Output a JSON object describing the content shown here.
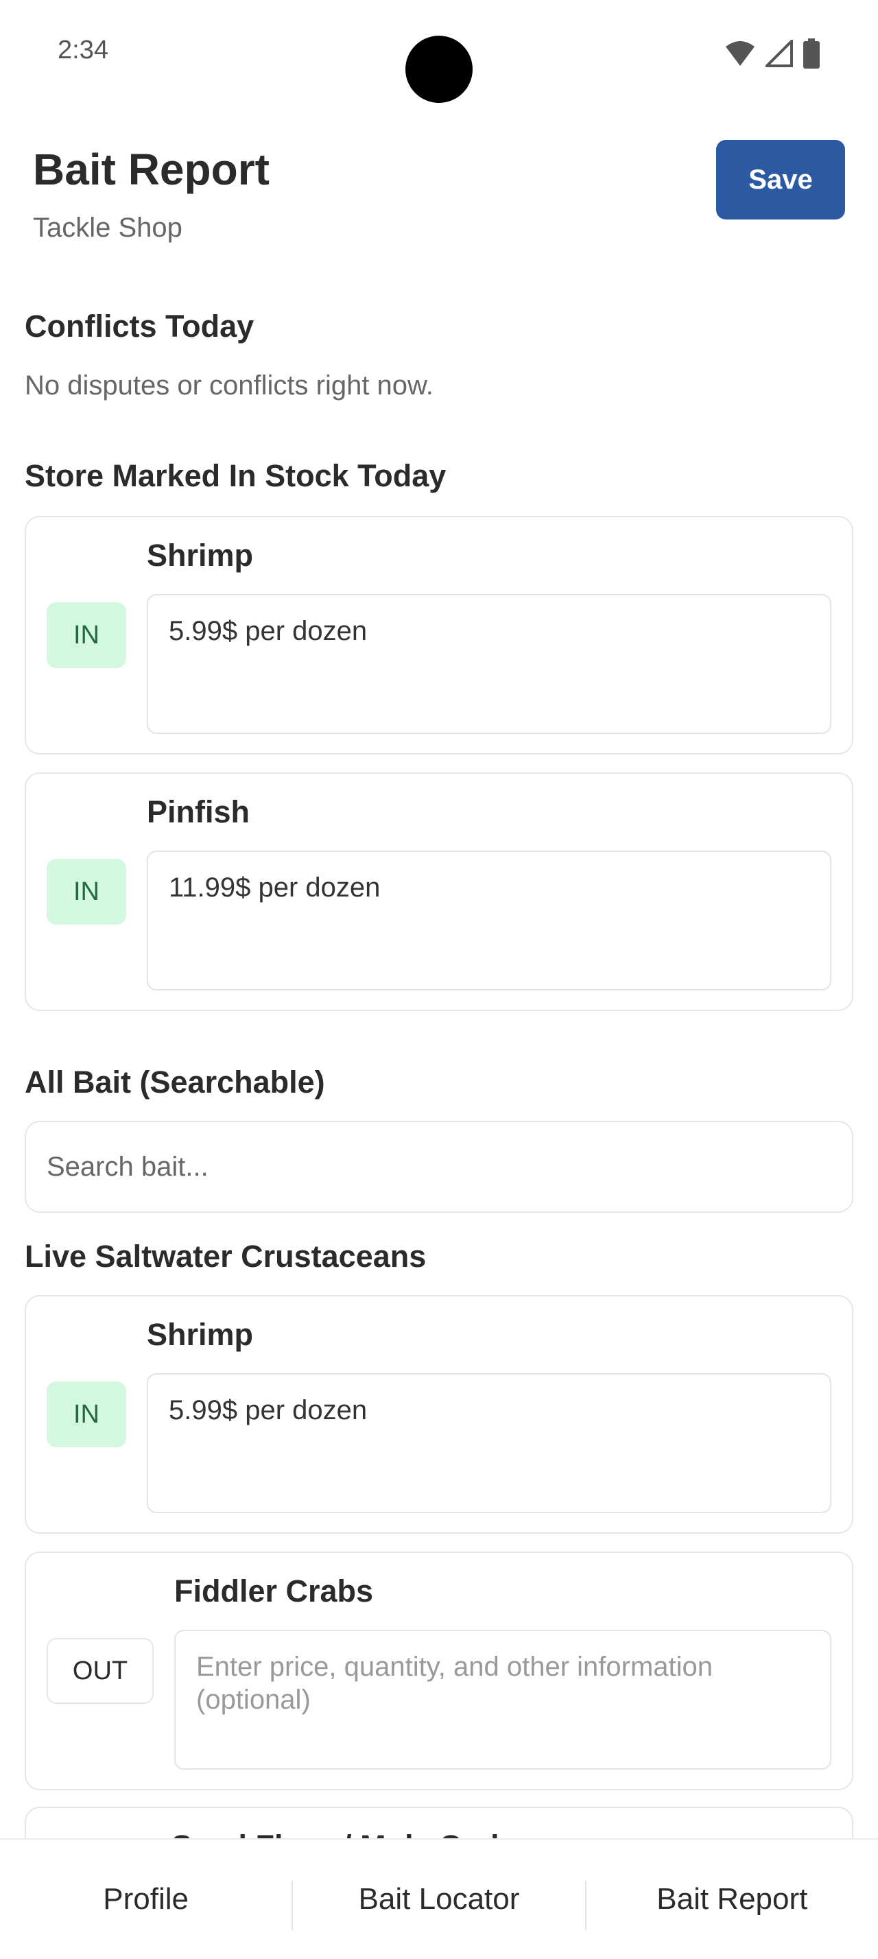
{
  "status_bar": {
    "time": "2:34",
    "icons": [
      "wifi-icon",
      "signal-icon",
      "battery-icon"
    ]
  },
  "header": {
    "title": "Bait Report",
    "subtitle": "Tackle Shop",
    "save_label": "Save"
  },
  "conflicts": {
    "title": "Conflicts Today",
    "message": "No disputes or conflicts right now."
  },
  "in_stock": {
    "title": "Store Marked In Stock Today",
    "items": [
      {
        "name": "Shrimp",
        "status": "IN",
        "info": "5.99$ per dozen"
      },
      {
        "name": "Pinfish",
        "status": "IN",
        "info": "11.99$ per dozen"
      }
    ]
  },
  "all_bait": {
    "title": "All Bait (Searchable)",
    "search_placeholder": "Search bait..."
  },
  "category": {
    "title": "Live Saltwater Crustaceans",
    "items": [
      {
        "name": "Shrimp",
        "status": "IN",
        "info": "5.99$ per dozen"
      },
      {
        "name": "Fiddler Crabs",
        "status": "OUT",
        "placeholder": "Enter price, quantity, and other information (optional)"
      }
    ],
    "partial_item_name": "Sand Fleas / Mole Crabs"
  },
  "bottom_nav": {
    "items": [
      "Profile",
      "Bait Locator",
      "Bait Report"
    ]
  },
  "colors": {
    "accent": "#2b5aa3",
    "in_badge_bg": "#d4f7e0",
    "in_badge_text": "#1e6b3e"
  }
}
